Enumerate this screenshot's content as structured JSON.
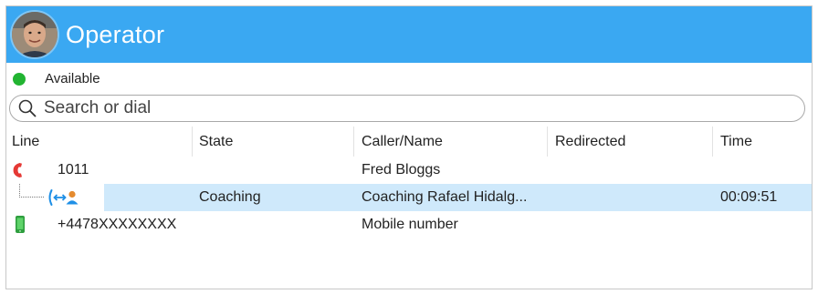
{
  "header": {
    "title": "Operator"
  },
  "status": {
    "label": "Available",
    "color": "#22b432"
  },
  "search": {
    "placeholder": "Search or dial"
  },
  "columns": [
    "Line",
    "State",
    "Caller/Name",
    "Redirected",
    "Time"
  ],
  "rows": [
    {
      "line": "1011",
      "state": "",
      "caller": "Fred Bloggs",
      "redirected": "",
      "time": "",
      "icon": "desk-phone-icon"
    },
    {
      "line": "",
      "state": "Coaching",
      "caller": "Coaching Rafael Hidalg...",
      "redirected": "",
      "time": "00:09:51",
      "icon": "coaching-icon"
    },
    {
      "line": "+4478XXXXXXXX",
      "state": "",
      "caller": "Mobile number",
      "redirected": "",
      "time": "",
      "icon": "mobile-phone-icon"
    }
  ],
  "colors": {
    "header": "#3aa8f2",
    "selected_row": "#cfe9fb",
    "accent": "#1e8fe6",
    "phone_red": "#e53935",
    "mobile_green": "#2e9e3e"
  }
}
